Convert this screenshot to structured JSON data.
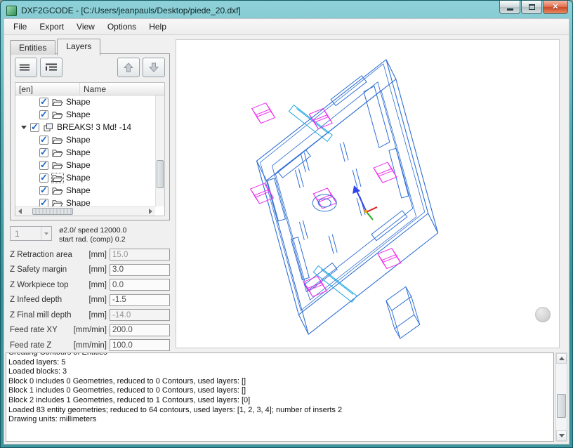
{
  "window": {
    "title": "DXF2GCODE - [C:/Users/jeanpauls/Desktop/piede_20.dxf]",
    "controls": {
      "close_glyph": "✕"
    }
  },
  "menu": {
    "items": [
      "File",
      "Export",
      "View",
      "Options",
      "Help"
    ]
  },
  "tabs": {
    "entities": "Entities",
    "layers": "Layers"
  },
  "tree": {
    "header": {
      "col1": "[en]",
      "col2": "Name"
    },
    "rows": [
      {
        "label": "Shape",
        "level": 2,
        "icon": "folder",
        "checked": true
      },
      {
        "label": "Shape",
        "level": 2,
        "icon": "folder",
        "checked": true
      },
      {
        "label": "BREAKS! 3 Md! -14",
        "level": 1,
        "icon": "block",
        "checked": true,
        "expanded": true
      },
      {
        "label": "Shape",
        "level": 2,
        "icon": "folder",
        "checked": true
      },
      {
        "label": "Shape",
        "level": 2,
        "icon": "folder",
        "checked": true
      },
      {
        "label": "Shape",
        "level": 2,
        "icon": "folder",
        "checked": true
      },
      {
        "label": "Shape",
        "level": 2,
        "icon": "folder",
        "checked": true
      },
      {
        "label": "Shape",
        "level": 2,
        "icon": "folder",
        "checked": true
      },
      {
        "label": "Shape",
        "level": 2,
        "icon": "folder",
        "checked": true
      }
    ]
  },
  "params": {
    "tool_selector": "1",
    "tool_info_line1": "ø2.0/ speed 12000.0",
    "tool_info_line2": "start rad. (comp) 0.2",
    "fields": [
      {
        "label": "Z Retraction area",
        "unit": "[mm]",
        "value": "15.0"
      },
      {
        "label": "Z Safety margin",
        "unit": "[mm]",
        "value": "3.0"
      },
      {
        "label": "Z Workpiece top",
        "unit": "[mm]",
        "value": "0.0"
      },
      {
        "label": "Z Infeed depth",
        "unit": "[mm]",
        "value": "-1.5"
      },
      {
        "label": "Z Final mill depth",
        "unit": "[mm]",
        "value": "-14.0"
      },
      {
        "label": "Feed rate XY",
        "unit": "[mm/min]",
        "value": "200.0"
      },
      {
        "label": "Feed rate Z",
        "unit": "[mm/min]",
        "value": "100.0"
      }
    ]
  },
  "log": {
    "lines": [
      "Creating Contours of Entities",
      "Loaded layers: 5",
      "Loaded blocks: 3",
      "Block 0 includes 0 Geometries, reduced to 0 Contours, used layers: []",
      "Block 1 includes 0 Geometries, reduced to 0 Contours, used layers: []",
      "Block 2 includes 1 Geometries, reduced to 1 Contours, used layers: [0]",
      "Loaded 83 entity geometries; reduced to 64 contours, used layers: [1, 2, 3, 4]; number of inserts 2",
      "Drawing units: millimeters"
    ]
  },
  "colors": {
    "line_blue": "#2e6ed4",
    "line_cyan": "#18a7e0",
    "line_magenta": "#ee2ff0",
    "titlebar_teal": "#3b929b"
  }
}
